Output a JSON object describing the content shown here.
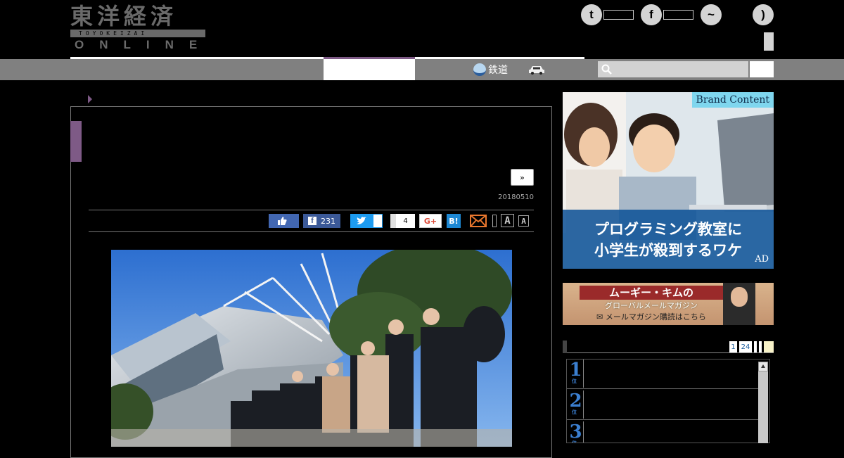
{
  "logo": {
    "kanji": "東洋経済",
    "romaji": "TOYOKEIZAI",
    "online": "ONLINE"
  },
  "nav": {
    "items": [
      {
        "label": "鉄道",
        "icon": "train-icon"
      },
      {
        "label": "",
        "icon": "car-icon"
      }
    ],
    "search_placeholder": ""
  },
  "social": [
    {
      "name": "twitter",
      "glyph": "t"
    },
    {
      "name": "facebook",
      "glyph": "f"
    },
    {
      "name": "messenger",
      "glyph": "~"
    },
    {
      "name": "rss",
      "glyph": ")"
    }
  ],
  "article": {
    "next_label": "»",
    "date": "20180510",
    "share": {
      "like_count": "",
      "facebook_count": "231",
      "twitter_count": "",
      "pocket_count": "4"
    },
    "font_small": "A",
    "font_large": "A"
  },
  "sidebar": {
    "brand_ad": {
      "tag": "Brand Content",
      "line1": "プログラミング教室に",
      "line2": "小学生が殺到するワケ",
      "ad_label": "AD"
    },
    "mail_ad": {
      "title": "ムーギー・キムの",
      "subtitle": "グローバルメールマガジン",
      "cta": "メールマガジン購読はこちら"
    },
    "ranking": {
      "tabs": [
        "1",
        "24",
        "",
        "",
        ""
      ],
      "ranks": [
        "1",
        "2",
        "3"
      ],
      "rank_suffix": "位"
    }
  },
  "colors": {
    "accent_purple": "#7e5a86",
    "nav_gray": "#808080",
    "rank_blue": "#3b7fd0"
  }
}
